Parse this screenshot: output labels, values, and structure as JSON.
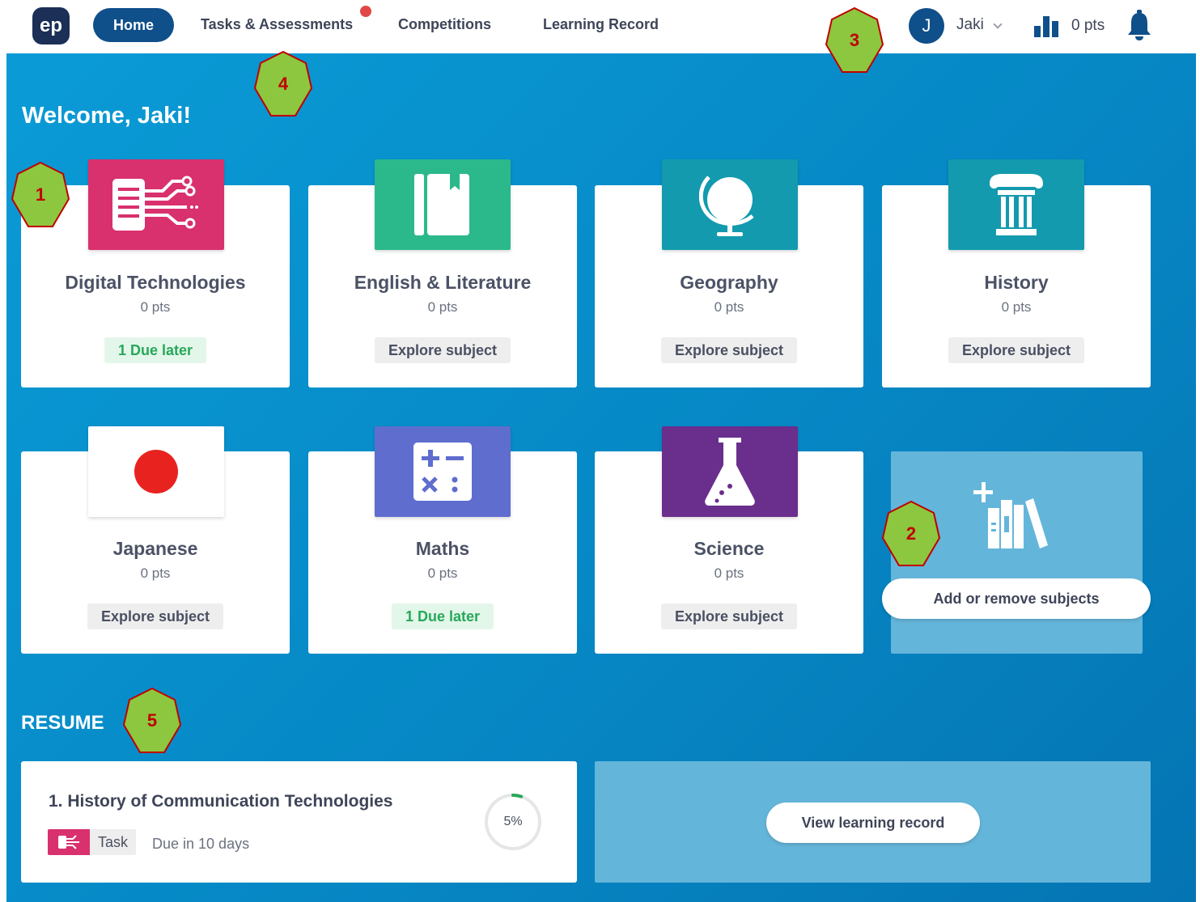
{
  "nav": {
    "logo": "ep",
    "home": "Home",
    "tasks": "Tasks & Assessments",
    "competitions": "Competitions",
    "learning_record": "Learning Record",
    "user_initial": "J",
    "user_name": "Jaki",
    "points": "0 pts"
  },
  "welcome": "Welcome, Jaki!",
  "subjects": [
    {
      "name": "Digital Technologies",
      "pts": "0 pts",
      "action": "1 Due later",
      "color": "#d9306e",
      "icon": "circuit-icon"
    },
    {
      "name": "English & Literature",
      "pts": "0 pts",
      "action": "Explore subject",
      "color": "#2bb98c",
      "icon": "book-icon"
    },
    {
      "name": "Geography",
      "pts": "0 pts",
      "action": "Explore subject",
      "color": "#139aae",
      "icon": "globe-icon"
    },
    {
      "name": "History",
      "pts": "0 pts",
      "action": "Explore subject",
      "color": "#139aae",
      "icon": "column-icon"
    },
    {
      "name": "Japanese",
      "pts": "0 pts",
      "action": "Explore subject",
      "color": "#ffffff",
      "icon": "japan-flag-icon"
    },
    {
      "name": "Maths",
      "pts": "0 pts",
      "action": "1 Due later",
      "color": "#5f6dcf",
      "icon": "calculator-icon"
    },
    {
      "name": "Science",
      "pts": "0 pts",
      "action": "Explore subject",
      "color": "#6a2e8c",
      "icon": "flask-icon"
    }
  ],
  "add_subjects": "Add or remove subjects",
  "resume": {
    "heading": "RESUME",
    "task_title": "1. History of Communication Technologies",
    "tag": "Task",
    "due": "Due in 10 days",
    "progress_label": "5%",
    "progress": 0.05,
    "view_record": "View learning record"
  },
  "markers": [
    "1",
    "2",
    "3",
    "4",
    "5"
  ],
  "colors": {
    "accent": "#0f4f8a",
    "due": "#27a85a",
    "marker_fill": "#8dc63f",
    "marker_stroke": "#c00000"
  }
}
